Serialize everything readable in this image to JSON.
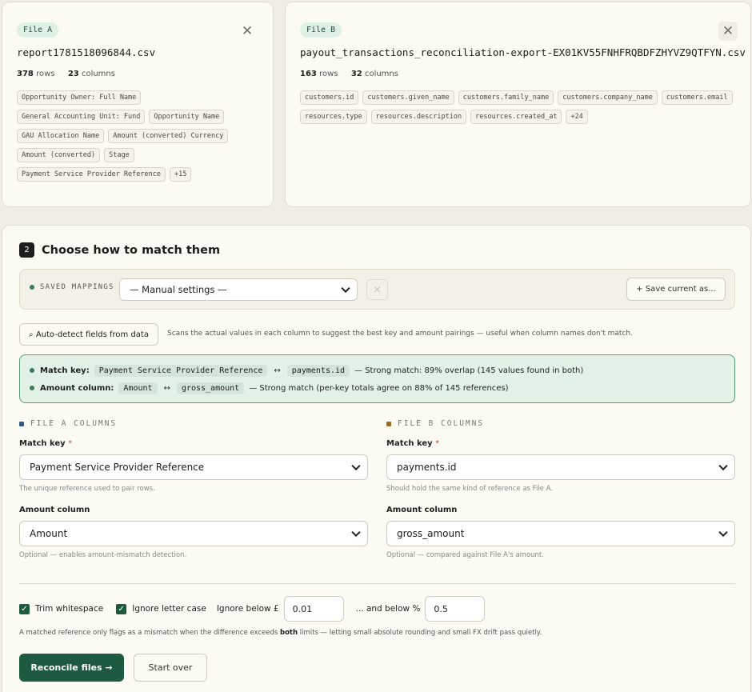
{
  "file_a": {
    "tag": "File A",
    "filename": "report1781518096844.csv",
    "rows": "378",
    "rows_label": "rows",
    "columns": "23",
    "columns_label": "columns",
    "chips": [
      "Opportunity Owner: Full Name",
      "General Accounting Unit: Fund",
      "Opportunity Name",
      "GAU Allocation Name",
      "Amount (converted) Currency",
      "Amount (converted)",
      "Stage",
      "Payment Service Provider Reference",
      "+15"
    ]
  },
  "file_b": {
    "tag": "File B",
    "filename": "payout_transactions_reconciliation-export-EX01KV55FNHFRQBDFZHYVZ9QTFYN.csv",
    "rows": "163",
    "rows_label": "rows",
    "columns": "32",
    "columns_label": "columns",
    "chips": [
      "customers.id",
      "customers.given_name",
      "customers.family_name",
      "customers.company_name",
      "customers.email",
      "resources.type",
      "resources.description",
      "resources.created_at",
      "+24"
    ]
  },
  "step": {
    "number": "2",
    "title": "Choose how to match them"
  },
  "saved_mappings": {
    "label": "SAVED MAPPINGS",
    "selected": "— Manual settings —",
    "clear_icon": "×",
    "save_label": "+ Save current as..."
  },
  "auto_detect": {
    "button_label": "⌕ Auto-detect fields from data",
    "hint": "Scans the actual values in each column to suggest the best key and amount pairings — useful when column names don't match."
  },
  "detection": {
    "match_key": {
      "label": "Match key:",
      "a": "Payment Service Provider Reference",
      "b": "payments.id",
      "description": "— Strong match: 89% overlap (145 values found in both)"
    },
    "amount": {
      "label": "Amount column:",
      "a": "Amount",
      "b": "gross_amount",
      "description": "— Strong match (per-key totals agree on 88% of 145 references)"
    },
    "arrow": "↔"
  },
  "file_a_columns": {
    "header": "FILE A COLUMNS",
    "match_key_label": "Match key",
    "required_mark": "*",
    "match_key_value": "Payment Service Provider Reference",
    "match_key_help": "The unique reference used to pair rows.",
    "amount_label": "Amount column",
    "amount_value": "Amount",
    "amount_help": "Optional — enables amount-mismatch detection."
  },
  "file_b_columns": {
    "header": "FILE B COLUMNS",
    "match_key_label": "Match key",
    "required_mark": "*",
    "match_key_value": "payments.id",
    "match_key_help": "Should hold the same kind of reference as File A.",
    "amount_label": "Amount column",
    "amount_value": "gross_amount",
    "amount_help": "Optional — compared against File A's amount."
  },
  "options": {
    "trim_label": "Trim whitespace",
    "case_label": "Ignore letter case",
    "ignore_below_label": "Ignore below £",
    "ignore_below_value": "0.01",
    "and_below_label": "... and below %",
    "and_below_value": "0.5",
    "check": "✓",
    "note_before": "A matched reference only flags as a mismatch when the difference exceeds ",
    "note_bold": "both",
    "note_after": " limits — letting small absolute rounding and small FX drift pass quietly."
  },
  "actions": {
    "reconcile": "Reconcile files →",
    "start_over": "Start over"
  },
  "colors": {
    "accent_green": "#1e5a3f",
    "match_bg": "#e1f1e6",
    "file_a_marker": "#2f5a8a",
    "file_b_marker": "#9b6a1c"
  }
}
